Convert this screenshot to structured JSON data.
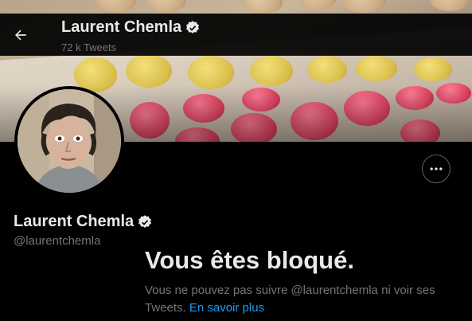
{
  "header": {
    "name": "Laurent Chemla",
    "tweet_count": "72 k Tweets"
  },
  "profile": {
    "name": "Laurent Chemla",
    "handle": "@laurentchemla",
    "verified_icon": "verified-badge-icon"
  },
  "blocked": {
    "title": "Vous êtes bloqué.",
    "message": "Vous ne pouvez pas suivre @laurentchemla ni voir ses Tweets.",
    "link": "En savoir plus"
  },
  "icons": {
    "back": "arrow-left-icon",
    "more": "more-horizontal-icon"
  },
  "colors": {
    "background": "#000000",
    "text_primary": "#e7e9ea",
    "text_secondary": "#71767b",
    "link": "#1d9bf0"
  }
}
